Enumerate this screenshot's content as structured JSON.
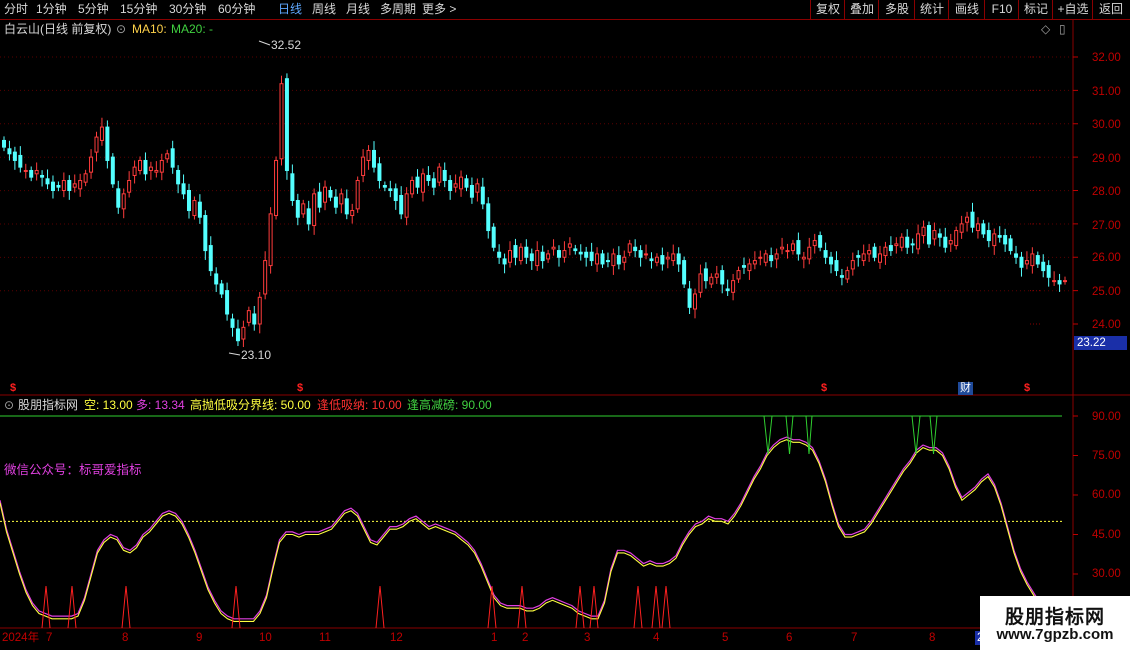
{
  "toolbar": {
    "periods": [
      "分时",
      "1分钟",
      "5分钟",
      "15分钟",
      "30分钟",
      "60分钟",
      "日线",
      "周线",
      "月线",
      "多周期",
      "更多 >"
    ],
    "active_period": "日线",
    "buttons": [
      "复权",
      "叠加",
      "多股",
      "统计",
      "画线",
      "F10",
      "标记",
      "+自选",
      "返回"
    ]
  },
  "main_panel": {
    "stock_name": "白云山(日线 前复权)",
    "ma10_label": "MA10:",
    "ma20_label": "MA20: -",
    "high_marker": "32.52",
    "low_marker": "23.10",
    "current_price": "23.22",
    "price_axis": [
      "32.00",
      "31.00",
      "30.00",
      "29.00",
      "28.00",
      "27.00",
      "26.00",
      "25.00",
      "24.00"
    ],
    "event_badge": "财",
    "event_marks": [
      "$",
      "$",
      "$",
      "$"
    ]
  },
  "indicator_panel": {
    "name": "股朋指标网",
    "kong": "空: 13.00",
    "duo": "多: 13.34",
    "boundary": "高抛低吸分界线: 50.00",
    "low_buy": "逢低吸纳: 10.00",
    "high_sell": "逢高减磅: 90.00",
    "axis": [
      "90.00",
      "75.00",
      "60.00",
      "45.00",
      "30.00"
    ],
    "wechat_note": "微信公众号：标哥爱指标"
  },
  "date_axis": [
    "2024年",
    "7",
    "8",
    "9",
    "10",
    "11",
    "12",
    "1",
    "2",
    "3",
    "4",
    "5",
    "6",
    "7",
    "8",
    "2"
  ],
  "watermark": {
    "title": "股朋指标网",
    "url": "www.7gpzb.com"
  },
  "chart_data": [
    {
      "type": "candlestick",
      "title": "白云山(日线 前复权)",
      "ylim": [
        23.4,
        32.6
      ],
      "y_ticks": [
        24,
        25,
        26,
        27,
        28,
        29,
        30,
        31,
        32
      ],
      "closes": [
        29.3,
        29.1,
        28.9,
        28.7,
        28.6,
        28.4,
        28.6,
        28.4,
        28.2,
        28.0,
        28.1,
        28.3,
        28.0,
        28.2,
        28.3,
        28.5,
        29.0,
        29.6,
        29.9,
        28.9,
        28.2,
        27.5,
        27.9,
        28.3,
        28.7,
        28.9,
        28.5,
        28.7,
        28.6,
        28.9,
        29.1,
        28.7,
        28.2,
        27.9,
        27.4,
        27.7,
        27.2,
        26.2,
        25.6,
        25.2,
        24.9,
        24.3,
        23.9,
        23.5,
        23.9,
        24.4,
        24.0,
        24.8,
        25.9,
        27.3,
        28.9,
        31.2,
        28.6,
        27.7,
        27.2,
        27.6,
        27.0,
        27.9,
        27.5,
        28.1,
        27.8,
        27.5,
        27.9,
        27.3,
        27.4,
        28.3,
        29.0,
        29.2,
        28.7,
        28.3,
        28.1,
        28.0,
        27.7,
        27.3,
        27.9,
        28.3,
        28.1,
        28.5,
        28.3,
        28.1,
        28.7,
        28.3,
        28.0,
        28.2,
        28.4,
        28.1,
        27.8,
        28.2,
        27.6,
        26.8,
        26.3,
        26.0,
        25.8,
        26.2,
        26.0,
        26.3,
        26.0,
        25.9,
        26.2,
        25.9,
        26.1,
        26.3,
        26.0,
        26.2,
        26.4,
        26.2,
        26.1,
        26.0,
        25.9,
        26.1,
        25.8,
        25.9,
        26.1,
        25.8,
        26.0,
        26.4,
        26.2,
        26.0,
        26.1,
        25.9,
        26.0,
        25.8,
        26.0,
        26.1,
        25.8,
        25.2,
        24.5,
        24.9,
        25.5,
        25.3,
        25.4,
        25.5,
        25.2,
        25.0,
        25.3,
        25.6,
        25.7,
        25.8,
        25.9,
        26.0,
        26.1,
        25.9,
        26.1,
        26.3,
        26.2,
        26.4,
        26.1,
        26.0,
        26.3,
        26.5,
        26.3,
        26.0,
        25.8,
        25.6,
        25.4,
        25.6,
        25.9,
        26.0,
        26.1,
        26.2,
        26.0,
        26.1,
        26.3,
        26.2,
        26.4,
        26.6,
        26.3,
        26.4,
        26.7,
        26.9,
        26.4,
        26.8,
        26.6,
        26.3,
        26.5,
        26.8,
        27.0,
        27.2,
        26.9,
        27.0,
        26.7,
        26.5,
        26.7,
        26.6,
        26.4,
        26.2,
        26.0,
        25.7,
        25.9,
        26.1,
        25.8,
        25.6,
        25.4,
        25.3,
        25.2,
        25.3
      ]
    },
    {
      "type": "line",
      "ylim": [
        20,
        95
      ],
      "y_ticks": [
        30,
        45,
        60,
        75,
        90
      ],
      "series": [
        {
          "name": "空",
          "values": [
            57,
            46,
            38,
            30,
            23,
            18,
            15,
            14,
            13,
            13,
            13,
            13,
            14,
            20,
            29,
            38,
            42,
            44,
            43,
            39,
            38,
            40,
            44,
            46,
            49,
            52,
            53,
            52,
            49,
            44,
            38,
            31,
            24,
            19,
            15,
            13,
            12,
            12,
            12,
            12,
            15,
            21,
            32,
            42,
            45,
            45,
            44,
            45,
            45,
            45,
            46,
            47,
            50,
            53,
            54,
            52,
            47,
            42,
            41,
            44,
            47,
            47,
            48,
            50,
            51,
            49,
            47,
            48,
            47,
            46,
            45,
            43,
            41,
            38,
            33,
            27,
            21,
            18,
            17,
            17,
            17,
            16,
            16,
            17,
            19,
            20,
            19,
            18,
            17,
            15,
            14,
            13,
            13,
            19,
            31,
            38,
            38,
            37,
            35,
            33,
            34,
            33,
            33,
            34,
            36,
            41,
            45,
            48,
            49,
            51,
            50,
            50,
            49,
            52,
            56,
            61,
            66,
            70,
            75,
            78,
            80,
            81,
            80,
            80,
            79,
            77,
            72,
            65,
            56,
            48,
            44,
            44,
            45,
            46,
            49,
            53,
            57,
            61,
            65,
            69,
            72,
            76,
            78,
            77,
            77,
            75,
            70,
            63,
            58,
            60,
            62,
            65,
            67,
            63,
            56,
            47,
            38,
            31,
            26,
            22,
            18
          ]
        },
        {
          "name": "多",
          "values": [
            58,
            47,
            39,
            31,
            24,
            19,
            16,
            15,
            14,
            14,
            14,
            14,
            15,
            21,
            30,
            39,
            43,
            45,
            44,
            40,
            39,
            41,
            45,
            47,
            50,
            53,
            54,
            53,
            50,
            45,
            39,
            32,
            25,
            20,
            16,
            14,
            13,
            13,
            13,
            13,
            16,
            22,
            33,
            43,
            46,
            46,
            45,
            46,
            46,
            46,
            47,
            48,
            51,
            54,
            55,
            53,
            48,
            43,
            42,
            45,
            48,
            48,
            49,
            51,
            52,
            50,
            48,
            49,
            48,
            47,
            46,
            44,
            42,
            39,
            34,
            28,
            22,
            19,
            18,
            18,
            18,
            17,
            17,
            18,
            20,
            21,
            20,
            19,
            18,
            16,
            15,
            14,
            14,
            20,
            32,
            39,
            39,
            38,
            36,
            34,
            35,
            34,
            34,
            35,
            37,
            42,
            46,
            49,
            50,
            52,
            51,
            51,
            50,
            53,
            57,
            62,
            67,
            71,
            76,
            79,
            81,
            82,
            81,
            81,
            80,
            78,
            73,
            66,
            57,
            49,
            45,
            45,
            46,
            47,
            50,
            54,
            58,
            62,
            66,
            70,
            73,
            77,
            79,
            78,
            78,
            76,
            71,
            64,
            59,
            61,
            63,
            66,
            68,
            64,
            57,
            48,
            39,
            32,
            27,
            23,
            19
          ]
        },
        {
          "name": "高抛低吸分界线",
          "values": [
            50
          ]
        },
        {
          "name": "逢低吸纳",
          "values": [
            10
          ]
        },
        {
          "name": "逢高减磅",
          "values": [
            90
          ]
        }
      ]
    }
  ]
}
